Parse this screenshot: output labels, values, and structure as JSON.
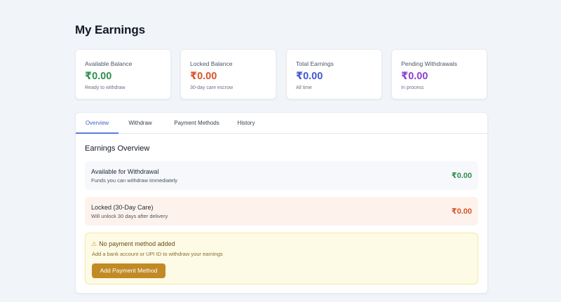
{
  "page": {
    "title": "My Earnings"
  },
  "stats": [
    {
      "label": "Available Balance",
      "value": "₹0.00",
      "sub": "Ready to withdraw",
      "color": "#2f8f4e"
    },
    {
      "label": "Locked Balance",
      "value": "₹0.00",
      "sub": "30-day care escrow",
      "color": "#d9532b"
    },
    {
      "label": "Total Earnings",
      "value": "₹0.00",
      "sub": "All time",
      "color": "#4357d1"
    },
    {
      "label": "Pending Withdrawals",
      "value": "₹0.00",
      "sub": "In process",
      "color": "#8a3fd1"
    }
  ],
  "tabs": [
    {
      "label": "Overview",
      "active": true
    },
    {
      "label": "Withdraw",
      "active": false
    },
    {
      "label": "Payment Methods",
      "active": false
    },
    {
      "label": "History",
      "active": false
    }
  ],
  "overview": {
    "title": "Earnings Overview",
    "available": {
      "title": "Available for Withdrawal",
      "subtitle": "Funds you can withdraw immediately",
      "amount": "₹0.00",
      "color": "#2f8f4e"
    },
    "locked": {
      "title": "Locked (30-Day Care)",
      "subtitle": "Will unlock 30 days after delivery",
      "amount": "₹0.00",
      "color": "#d9532b"
    }
  },
  "notice": {
    "icon": "warning-icon",
    "title": "No payment method added",
    "description": "Add a bank account or UPI ID to withdraw your earnings",
    "button_label": "Add Payment Method"
  }
}
